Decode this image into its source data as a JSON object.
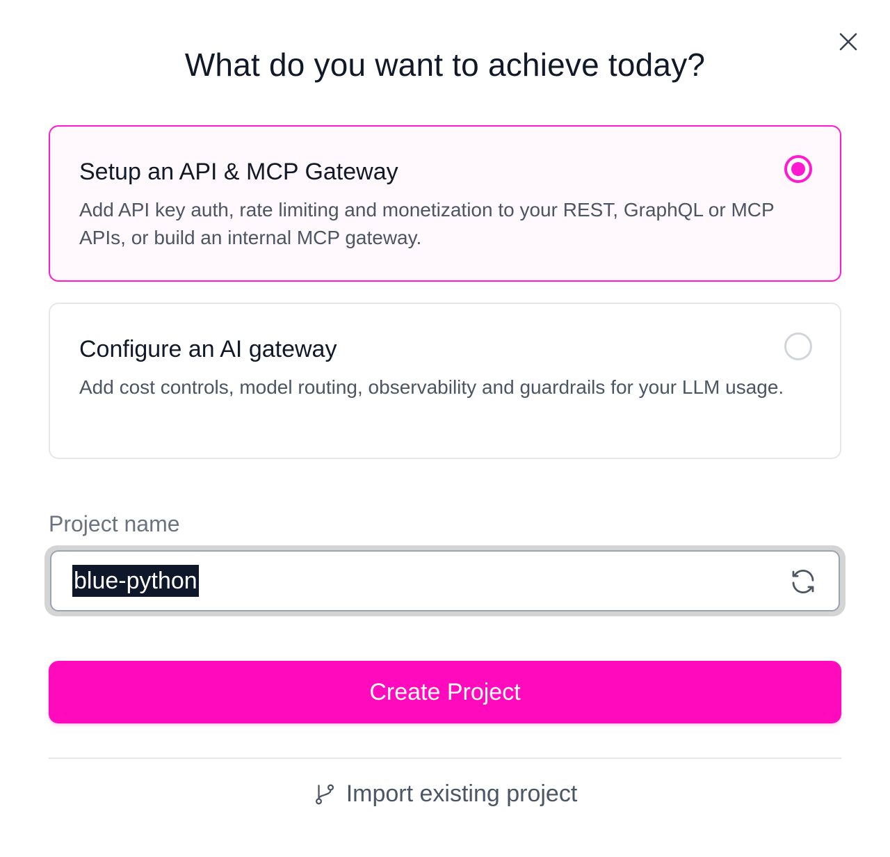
{
  "dialog": {
    "title": "What do you want to achieve today?"
  },
  "options": [
    {
      "title": "Setup an API & MCP Gateway",
      "description": "Add API key auth, rate limiting and monetization to your REST, GraphQL or MCP APIs, or build an internal MCP gateway.",
      "selected": true
    },
    {
      "title": "Configure an AI gateway",
      "description": "Add cost controls, model routing, observability and guardrails for your LLM usage.",
      "selected": false
    }
  ],
  "project": {
    "label": "Project name",
    "value": "blue-python"
  },
  "actions": {
    "create_label": "Create Project",
    "import_label": "Import existing project"
  },
  "icons": {
    "close": "close-icon",
    "refresh": "refresh-icon",
    "import": "git-branch-icon"
  },
  "colors": {
    "accent": "#ff0bbd",
    "selected_border": "#ff1ad1",
    "selected_bg": "#fff8fc"
  }
}
